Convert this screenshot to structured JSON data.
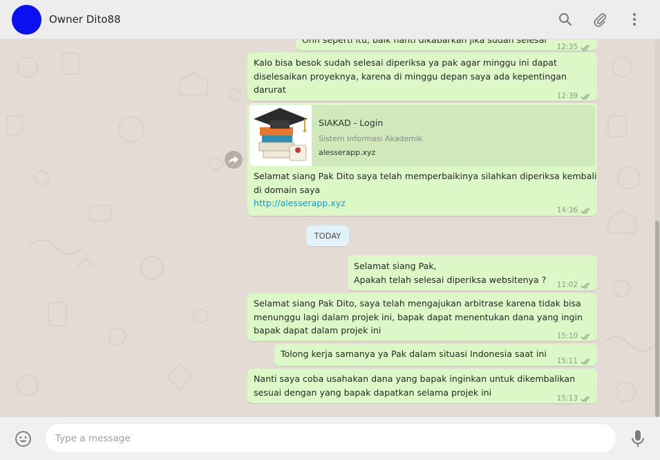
{
  "header": {
    "contact_name": "Owner Dito88",
    "icons": [
      "search-icon",
      "attach-icon",
      "menu-icon"
    ],
    "avatar_color": "#0b10f0"
  },
  "messages": [
    {
      "type": "out",
      "text": "Ohh seperti itu, baik nanti dikabarkan jika sudah selesai",
      "time": "12:35"
    },
    {
      "type": "out",
      "text": "Kalo bisa besok sudah selesai diperiksa ya pak agar minggu ini dapat\ndiselesaikan proyeknya, karena di minggu depan saya ada kepentingan\ndarurat",
      "time": "12:39"
    },
    {
      "type": "out",
      "preview": {
        "title": "SIAKAD - Login",
        "subtitle": "Sistem Informasi Akademik",
        "domain": "alesserapp.xyz"
      },
      "text": "Selamat siang Pak Dito saya telah memperbaikinya silahkan diperiksa kembali\ndi domain saya",
      "link": "http://alesserapp.xyz",
      "time": "14:36"
    },
    {
      "type": "out",
      "text": "Selamat siang Pak,\nApakah telah selesai diperiksa websitenya ?",
      "time": "11:02"
    },
    {
      "type": "out",
      "text": "Selamat siang Pak Dito, saya telah mengajukan arbitrase karena tidak bisa\nmenunggu lagi dalam projek ini, bapak dapat menentukan dana yang ingin\nbapak dapat dalam projek ini",
      "time": "15:10"
    },
    {
      "type": "out",
      "text": "Tolong kerja samanya ya Pak dalam situasi Indonesia saat ini",
      "time": "15:11"
    },
    {
      "type": "out",
      "text": "Nanti saya coba usahakan dana yang bapak inginkan untuk dikembalikan\nsesuai dengan yang bapak dapatkan selama projek ini",
      "time": "15:13"
    }
  ],
  "day_divider": "TODAY",
  "composer": {
    "placeholder": "Type a message"
  },
  "footer_icons": [
    "emoji-icon",
    "microphone-icon"
  ],
  "colors": {
    "outgoing_bubble": "#dcf8c6",
    "chat_bg": "#e4dcd4",
    "header_bg": "#ededed",
    "link": "#039be5",
    "day_chip": "#e1f2fb"
  }
}
